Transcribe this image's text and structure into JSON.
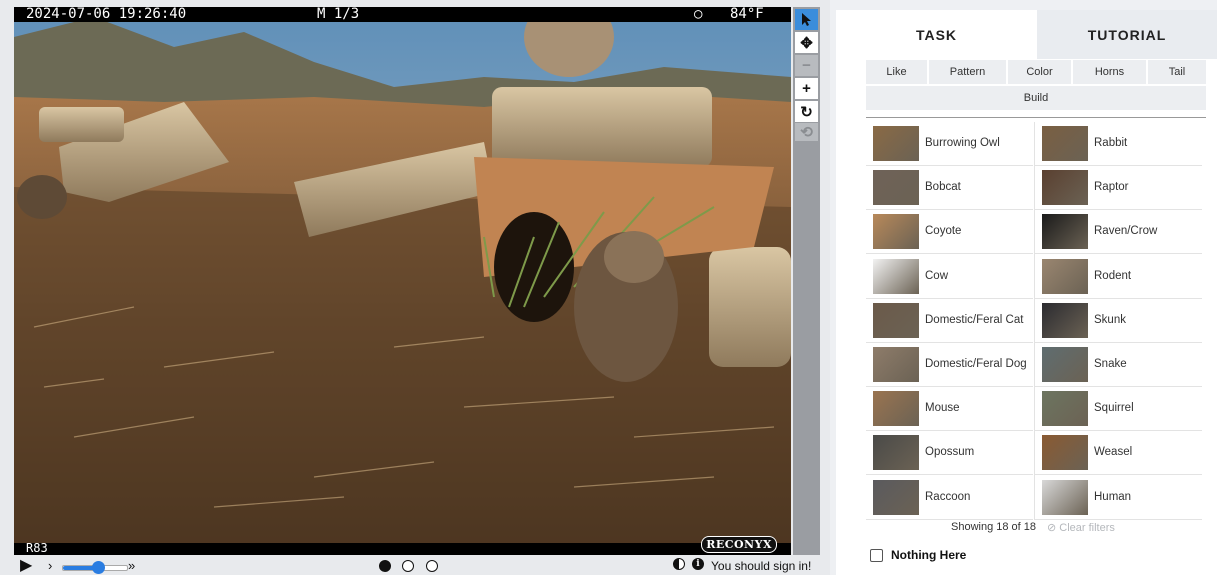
{
  "camera": {
    "datetime": "2024-07-06 19:26:40",
    "frame_mode": "M 1/3",
    "temp_symbol": "○",
    "temperature": "84°F",
    "camera_id": "R83",
    "brand": "RECONYX"
  },
  "tools": [
    "pointer-icon",
    "pan-icon",
    "zoom-out-icon",
    "zoom-in-icon",
    "rotate-icon",
    "reset-icon"
  ],
  "playback": {
    "play": "▶",
    "step": "›",
    "fast": "»",
    "speed_fraction": 0.55,
    "frames": [
      true,
      false,
      false
    ]
  },
  "signin_text": "You should sign in!",
  "tabs": {
    "task": "TASK",
    "tutorial": "TUTORIAL"
  },
  "filters": [
    "Like",
    "Pattern",
    "Color",
    "Horns",
    "Tail",
    "Build"
  ],
  "species": [
    {
      "name": "Burrowing Owl",
      "color": "#8a6a45"
    },
    {
      "name": "Rabbit",
      "color": "#7a5f42"
    },
    {
      "name": "Bobcat",
      "color": "#6f6258"
    },
    {
      "name": "Raptor",
      "color": "#5a4030"
    },
    {
      "name": "Coyote",
      "color": "#b8895a"
    },
    {
      "name": "Raven/Crow",
      "color": "#1a1a1a"
    },
    {
      "name": "Cow",
      "color": "#f2f2f2"
    },
    {
      "name": "Rodent",
      "color": "#9a8670"
    },
    {
      "name": "Domestic/Feral Cat",
      "color": "#6b5a4a"
    },
    {
      "name": "Skunk",
      "color": "#2b2b30"
    },
    {
      "name": "Domestic/Feral Dog",
      "color": "#8e7c6a"
    },
    {
      "name": "Snake",
      "color": "#5f6d70"
    },
    {
      "name": "Mouse",
      "color": "#9a7450"
    },
    {
      "name": "Squirrel",
      "color": "#6d7560"
    },
    {
      "name": "Opossum",
      "color": "#4a4a48"
    },
    {
      "name": "Weasel",
      "color": "#8a5a32"
    },
    {
      "name": "Raccoon",
      "color": "#5a5a5e"
    },
    {
      "name": "Human",
      "color": "#d8d8d8"
    }
  ],
  "showing_text": "Showing 18 of 18",
  "clear_filters": "⊘ Clear filters",
  "nothing_here": "Nothing Here"
}
